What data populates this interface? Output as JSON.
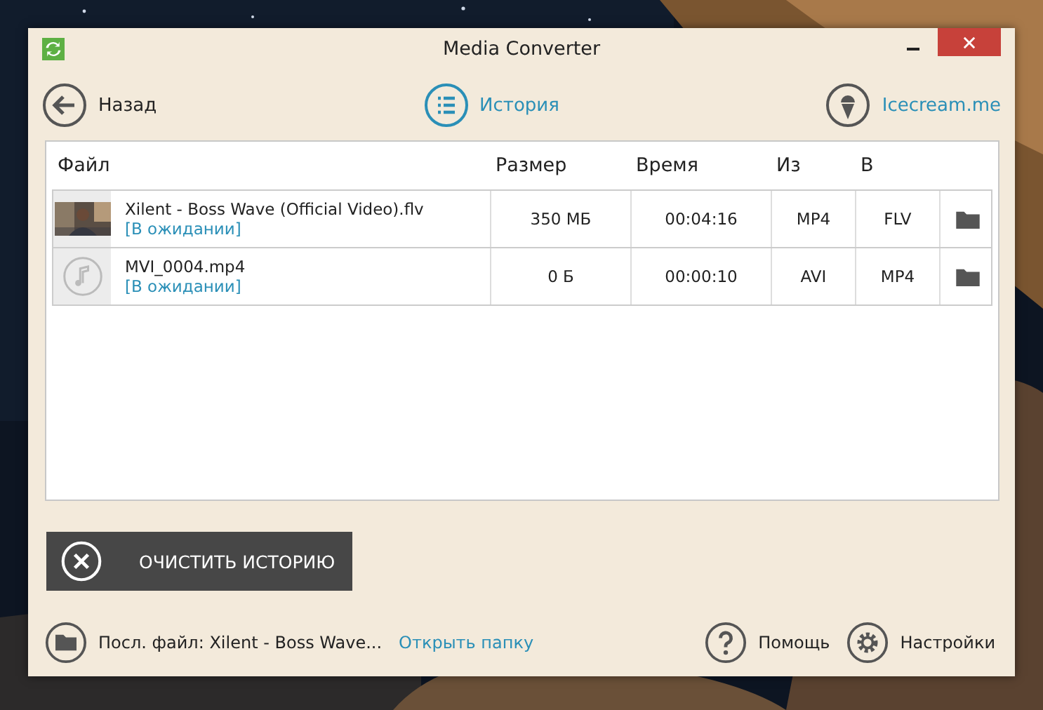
{
  "window": {
    "title": "Media Converter"
  },
  "nav": [
    {
      "label": "Назад",
      "kind": "back",
      "selected": false
    },
    {
      "label": "История",
      "kind": "history",
      "selected": true
    }
  ],
  "brand_link": "Icecream.me",
  "table": {
    "columns": [
      "Файл",
      "Размер",
      "Время",
      "Из",
      "В"
    ],
    "rows": [
      {
        "kind": "video",
        "name": "Xilent - Boss Wave (Official Video).flv",
        "status": "[В ожидании]",
        "size": "350 МБ",
        "time": "00:04:16",
        "from": "MP4",
        "to": "FLV"
      },
      {
        "kind": "audio",
        "name": "MVI_0004.mp4",
        "status": "[В ожидании]",
        "size": "0 Б",
        "time": "00:00:10",
        "from": "AVI",
        "to": "MP4"
      }
    ]
  },
  "clear_button": "ОЧИСТИТЬ ИСТОРИЮ",
  "footer": {
    "last_file": "Посл. файл: Xilent - Boss Wave...",
    "open_folder": "Открыть папку",
    "help": "Помощь",
    "settings": "Настройки"
  }
}
